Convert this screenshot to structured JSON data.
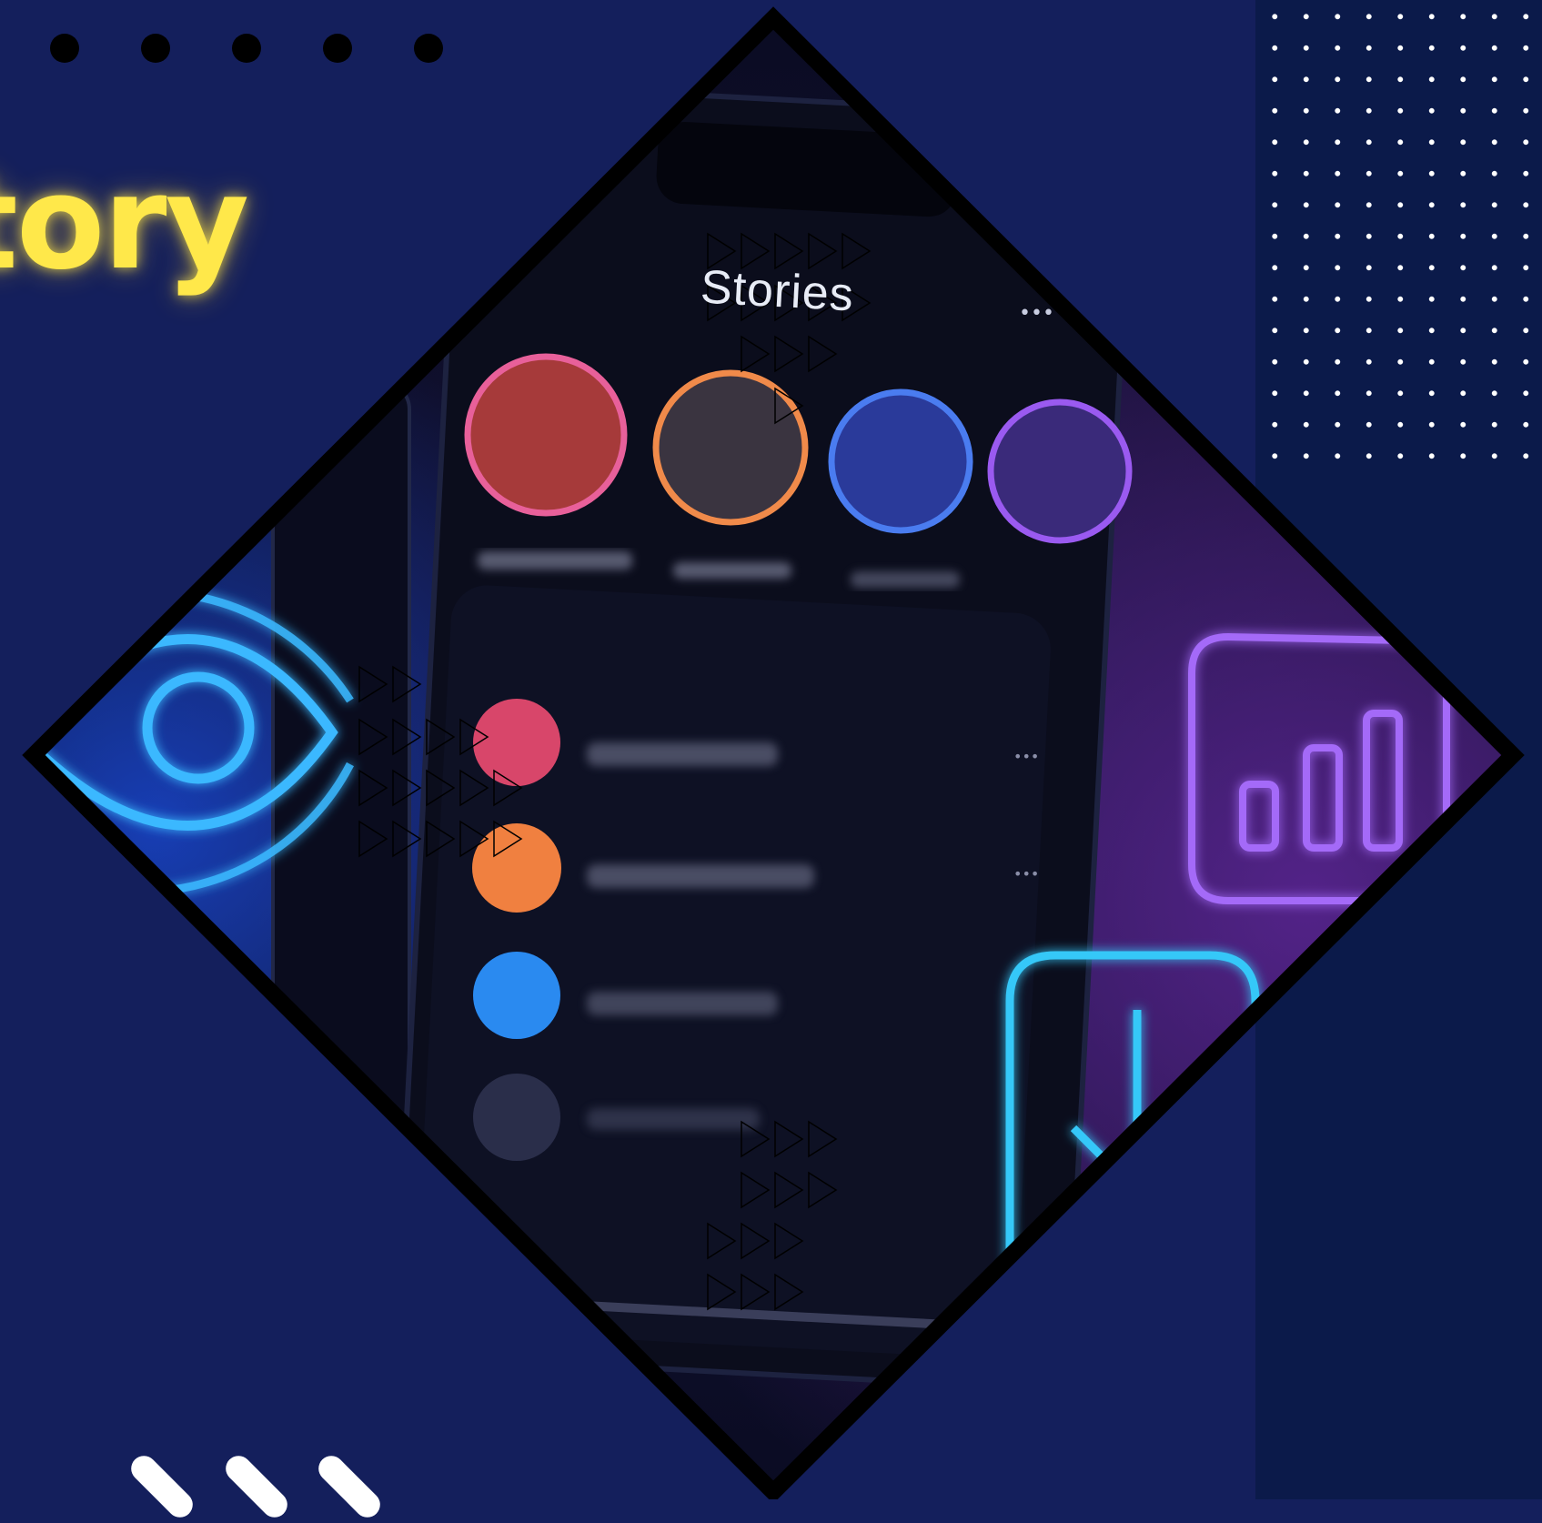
{
  "headline": {
    "text": "tory"
  },
  "phone": {
    "header_title": "Stories",
    "more_label": "•••",
    "story_rings": [
      {
        "ring_color": "#e8609a",
        "fill_color": "#a63a3a"
      },
      {
        "ring_color": "#f08a4a",
        "fill_color": "#3a3440"
      },
      {
        "ring_color": "#4a7cf0",
        "fill_color": "#2a3a9a"
      },
      {
        "ring_color": "#9a5af0",
        "fill_color": "#3a2a7a"
      }
    ],
    "list_avatars": [
      {
        "color": "#d8466a",
        "more": "•••"
      },
      {
        "color": "#f08040",
        "more": "•••"
      },
      {
        "color": "#2a8af0",
        "more": ""
      },
      {
        "color": "#2a2e4a",
        "more": ""
      }
    ]
  },
  "neon_icons": {
    "eye": {
      "color": "#3ab8ff"
    },
    "chart": {
      "color": "#a46af8"
    },
    "download": {
      "color": "#36c8f8"
    }
  },
  "colors": {
    "background": "#141f5c",
    "panel": "#0b1a4a",
    "headline": "#ffe84a",
    "frame": "#000000"
  }
}
